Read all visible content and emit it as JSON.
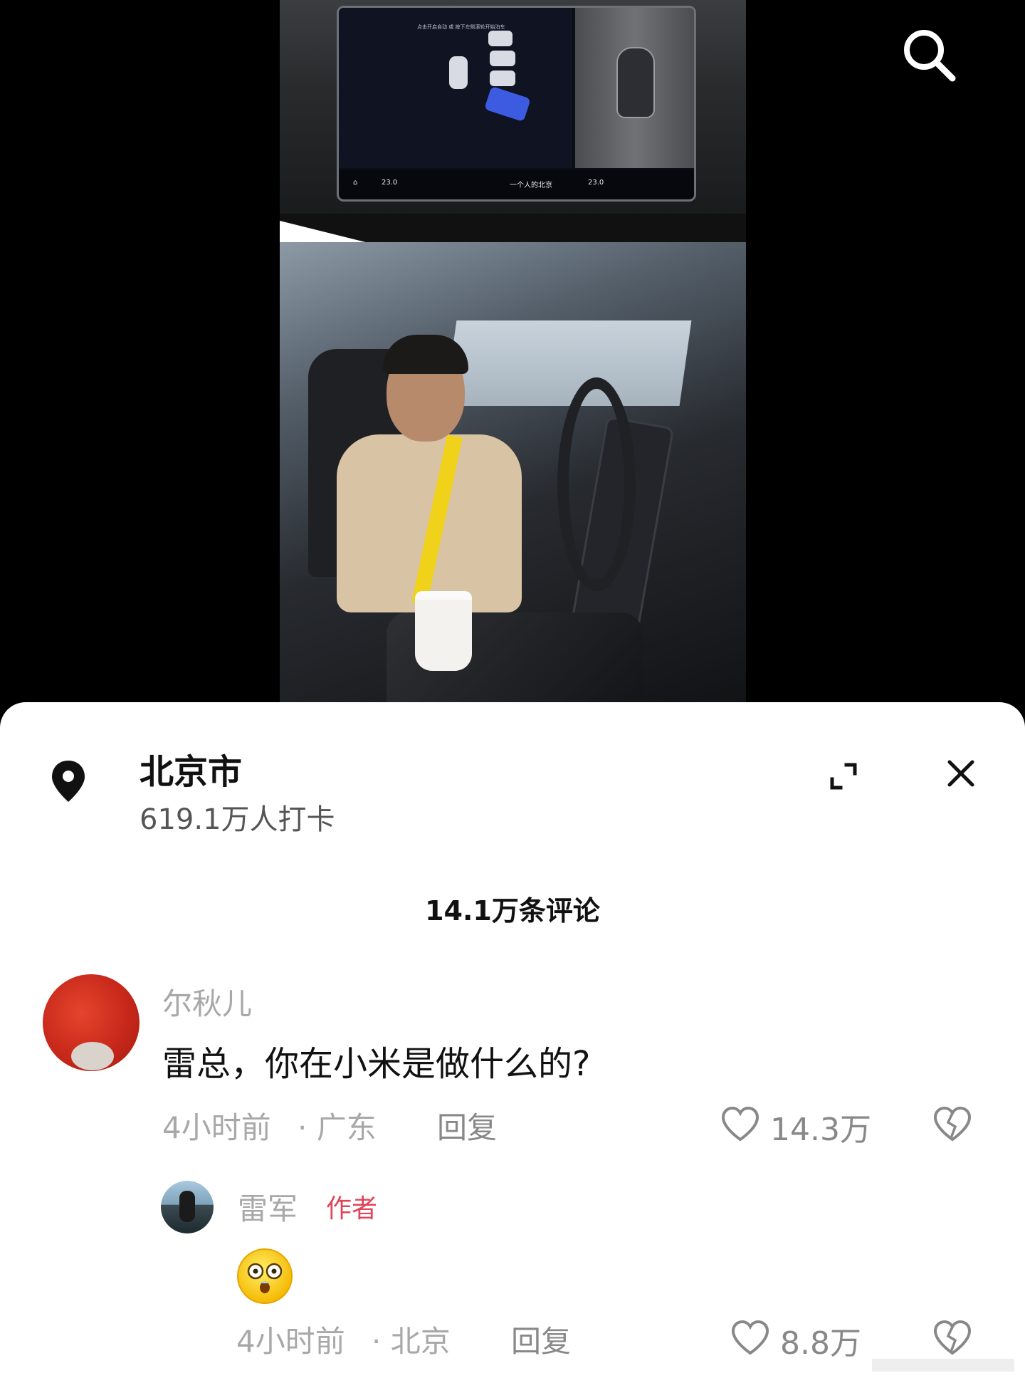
{
  "video": {
    "display_hint": "点击开启自动 或 按下左侧滚轮开始泊车",
    "display_temp_left": "23.0",
    "display_temp_right": "23.0",
    "display_song": "一个人的北京"
  },
  "sheet": {
    "location": {
      "title": "北京市",
      "checkins": "619.1万人打卡"
    },
    "comment_count": "14.1万条评论",
    "comments": [
      {
        "username": "尔秋儿",
        "text": "雷总，你在小米是做什么的?",
        "time": "4小时前",
        "region": "· 广东",
        "reply_label": "回复",
        "likes": "14.3万"
      },
      {
        "username": "雷军",
        "badge": "作者",
        "time": "4小时前",
        "region": "· 北京",
        "reply_label": "回复",
        "likes": "8.8万"
      }
    ]
  },
  "colors": {
    "author_badge": "#e0435a",
    "muted_text": "#a8a8a8",
    "sheet_bg": "#ffffff",
    "video_bg": "#000000"
  },
  "icons": [
    "search-icon",
    "location-pin-icon",
    "expand-icon",
    "close-icon",
    "heart-icon",
    "broken-heart-icon",
    "stunned-emoji-icon"
  ]
}
